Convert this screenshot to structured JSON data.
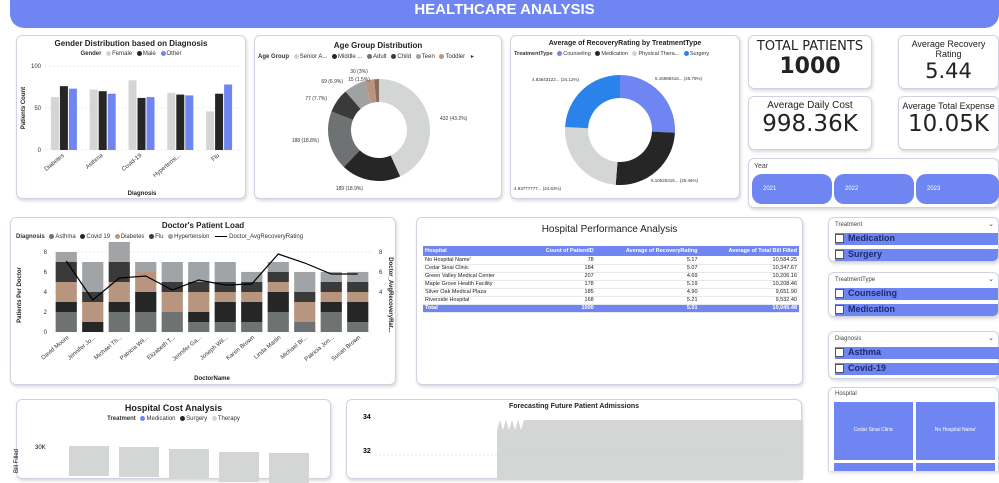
{
  "header": {
    "title": "HEALTHCARE ANALYSIS"
  },
  "colors": {
    "accent": "#6f86f2",
    "gray": "#d4d6d6",
    "dark": "#262626",
    "mid": "#6f7272",
    "tan": "#b8957f"
  },
  "gender_chart": {
    "title": "Gender Distribution based on Diagnosis",
    "legend_label": "Gender",
    "series_names": [
      "Female",
      "Male",
      "Other"
    ],
    "y_label": "Patients Count",
    "x_label": "Diagnosis",
    "y_ticks": [
      "0",
      "50",
      "100"
    ],
    "categories": [
      "Diabetes",
      "Asthma",
      "Covid-19",
      "Hypertensi...",
      "Flu"
    ],
    "female": [
      63,
      72,
      83,
      68,
      46
    ],
    "male": [
      76,
      70,
      62,
      66,
      67
    ],
    "other": [
      73,
      67,
      63,
      65,
      78
    ]
  },
  "age_chart": {
    "title": "Age Group Distribution",
    "legend_label": "Age Group",
    "legend": [
      "Senior A...",
      "Middle ...",
      "Adult",
      "Child",
      "Teen",
      "Toddler"
    ],
    "labels": [
      "432 (43.2%)",
      "189 (18.9%)",
      "188 (18.8%)",
      "77 (7.7%)",
      "69 (6.9%)",
      "30 (3%)",
      "15 (1.5%)"
    ],
    "values": [
      43.2,
      18.9,
      18.8,
      7.7,
      6.9,
      3.0,
      1.5
    ]
  },
  "recovery_chart": {
    "title": "Average of RecoveryRating by TreatmentType",
    "legend_label": "TreatmentType",
    "legend": [
      "Counseling",
      "Medication",
      "Physical Thera...",
      "Surgery"
    ],
    "labels": [
      "5.16988416... (25.79%)",
      "5.10526315... (25.46%)",
      "4.93777777... (24.63%)",
      "4.83643122... (24.12%)"
    ],
    "values": [
      25.79,
      25.46,
      24.63,
      24.12
    ]
  },
  "kpis": {
    "total_patients_label": "TOTAL PATIENTS",
    "total_patients": "1000",
    "avg_recovery_label": "Average Recovery Rating",
    "avg_recovery": "5.44",
    "avg_daily_cost_label": "Average Daily Cost",
    "avg_daily_cost": "998.36K",
    "avg_total_expense_label": "Average Total Expense",
    "avg_total_expense": "10.05K"
  },
  "year_slicer": {
    "label": "Year",
    "options": [
      "2021",
      "2022",
      "2023"
    ]
  },
  "doctor_chart": {
    "title": "Doctor's Patient Load",
    "legend_label": "Diagnosis",
    "legend": [
      "Asthma",
      "Covid 19",
      "Diabetes",
      "Flu",
      "Hypertension",
      "Doctor_AvgRecoveryRating"
    ],
    "y_label": "Patients Per Doctor",
    "y2_label": "Doctor_AvgRecoveryRat...",
    "x_label": "DoctorName",
    "y_ticks": [
      "0",
      "2",
      "4",
      "6",
      "8"
    ],
    "y2_ticks": [
      "4",
      "6",
      "8"
    ],
    "doctors": [
      "David Moore",
      "Jennifer Jo...",
      "Michael Th...",
      "Patricia Wil...",
      "Elizabeth T...",
      "Jennifer Ga...",
      "Joseph Wil...",
      "Karen Brown",
      "Linda Martin",
      "Michael Br...",
      "Patricia Jon...",
      "Susan Brown"
    ],
    "recovery": [
      7.1,
      3.2,
      5.4,
      5.6,
      4.2,
      5.2,
      4.7,
      4.8,
      7.8,
      6.9,
      5.8,
      5.8
    ]
  },
  "performance_table": {
    "title": "Hospital Performance Analysis",
    "columns": [
      "Hospital",
      "Count of PatientID",
      "Average of RecoveryRating",
      "Average of Total Bill Filled"
    ],
    "rows": [
      [
        "No Hospital Name'",
        "78",
        "5.17",
        "10,584.25"
      ],
      [
        "Cedar Sinai Clinic",
        "184",
        "5.07",
        "10,347.67"
      ],
      [
        "Green Valley Medical Center",
        "207",
        "4.69",
        "10,206.16"
      ],
      [
        "Maple Grove Health Facility",
        "178",
        "5.19",
        "10,208.46"
      ],
      [
        "Silver Oak Medical Plaza",
        "185",
        "4.90",
        "9,651.90"
      ],
      [
        "Riverside Hospital",
        "168",
        "5.21",
        "9,532.40"
      ]
    ],
    "total": [
      "Total",
      "1000",
      "5.01",
      "10,045.48"
    ]
  },
  "treatment_slicer": {
    "label": "Treatment",
    "items": [
      "Medication",
      "Surgery"
    ]
  },
  "treatment_type_slicer": {
    "label": "TreatmentType",
    "items": [
      "Counseling",
      "Medication"
    ]
  },
  "diagnosis_slicer": {
    "label": "Diagnosis",
    "items": [
      "Asthma",
      "Covid-19"
    ]
  },
  "hospital_slicer": {
    "label": "Hospital",
    "tiles": [
      "Cedar Sinai Clinic",
      "No Hospital Name'"
    ]
  },
  "cost_chart": {
    "title": "Hospital Cost Analysis",
    "legend_label": "Treatment",
    "legend": [
      "Medication",
      "Surgery",
      "Therapy"
    ],
    "y_label": "Bill Filled",
    "y_tick": "30K"
  },
  "forecast_chart": {
    "title": "Forecasting Future Patient Admissions",
    "y_ticks": [
      "34",
      "32"
    ]
  }
}
